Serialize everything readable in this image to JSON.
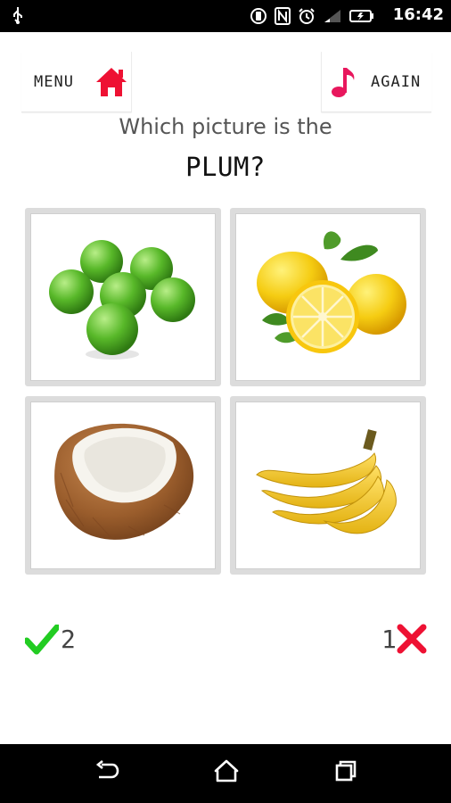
{
  "status_bar": {
    "time": "16:42",
    "icons": [
      "usb-icon",
      "rotation-icon",
      "nfc-icon",
      "alarm-icon",
      "signal-icon",
      "battery-icon"
    ]
  },
  "header": {
    "menu_label": "MENU",
    "again_label": "AGAIN",
    "home_icon": "home-icon",
    "music_icon": "music-note-icon"
  },
  "question": {
    "prompt": "Which picture is the",
    "target": "PLUM?"
  },
  "choices": [
    {
      "name": "green-plums-image"
    },
    {
      "name": "lemons-image"
    },
    {
      "name": "coconut-image"
    },
    {
      "name": "bananas-image"
    }
  ],
  "score": {
    "correct": "2",
    "wrong": "1"
  },
  "nav_bar": {
    "icons": [
      "back-icon",
      "home-icon",
      "recents-icon"
    ]
  },
  "colors": {
    "accent_red": "#ee1133",
    "note_pink": "#e8175d",
    "check_green": "#22cc22"
  }
}
